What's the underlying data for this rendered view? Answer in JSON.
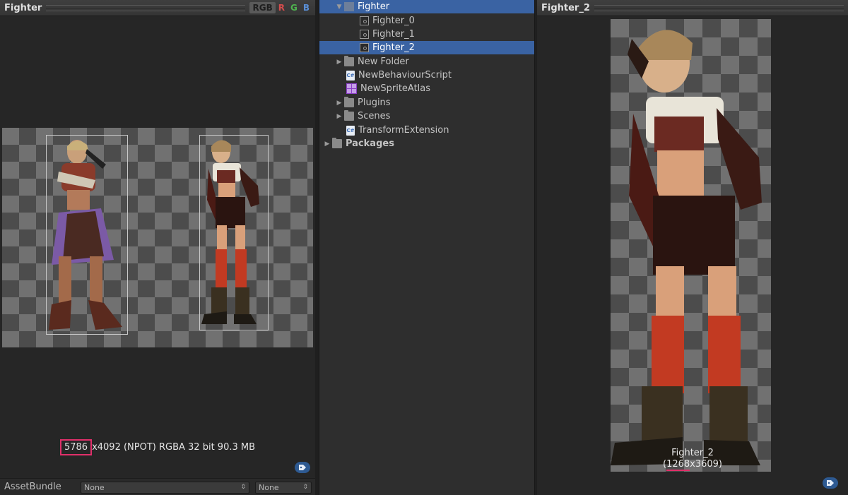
{
  "left_panel": {
    "title": "Fighter",
    "channels": [
      "RGB",
      "R",
      "G",
      "B"
    ],
    "info": {
      "width_highlight": "5786",
      "rest": "x4092 (NPOT)  RGBA 32 bit   90.3 MB"
    },
    "asset_bundle": {
      "label": "AssetBundle",
      "bundle_value": "None",
      "variant_value": "None"
    }
  },
  "hierarchy": {
    "items": [
      {
        "label": "Fighter",
        "icon": "texture-icon",
        "depth": 1,
        "expanded": true,
        "selected_parent": true
      },
      {
        "label": "Fighter_0",
        "icon": "sprite-icon",
        "depth": 2
      },
      {
        "label": "Fighter_1",
        "icon": "sprite-icon",
        "depth": 2
      },
      {
        "label": "Fighter_2",
        "icon": "sprite-icon",
        "depth": 2,
        "selected": true
      },
      {
        "label": "New Folder",
        "icon": "folder-icon",
        "depth": 1,
        "collapsed": true
      },
      {
        "label": "NewBehaviourScript",
        "icon": "csharp-script-icon",
        "depth": 1
      },
      {
        "label": "NewSpriteAtlas",
        "icon": "sprite-atlas-icon",
        "depth": 1
      },
      {
        "label": "Plugins",
        "icon": "folder-icon",
        "depth": 1,
        "collapsed": true
      },
      {
        "label": "Scenes",
        "icon": "folder-icon",
        "depth": 1,
        "collapsed": true
      },
      {
        "label": "TransformExtension",
        "icon": "csharp-script-icon",
        "depth": 1
      },
      {
        "label": "Packages",
        "icon": "folder-icon",
        "depth": 0,
        "collapsed": true
      }
    ],
    "script_icon_text": "C#"
  },
  "right_panel": {
    "title": "Fighter_2",
    "caption_name": "Fighter_2",
    "caption_dims_open": "(",
    "caption_width": "1268",
    "caption_dims_rest": "x3609)"
  },
  "colors": {
    "selection": "#3a63a3",
    "highlight_box": "#e0306a",
    "tag_button": "#2e5a92"
  }
}
